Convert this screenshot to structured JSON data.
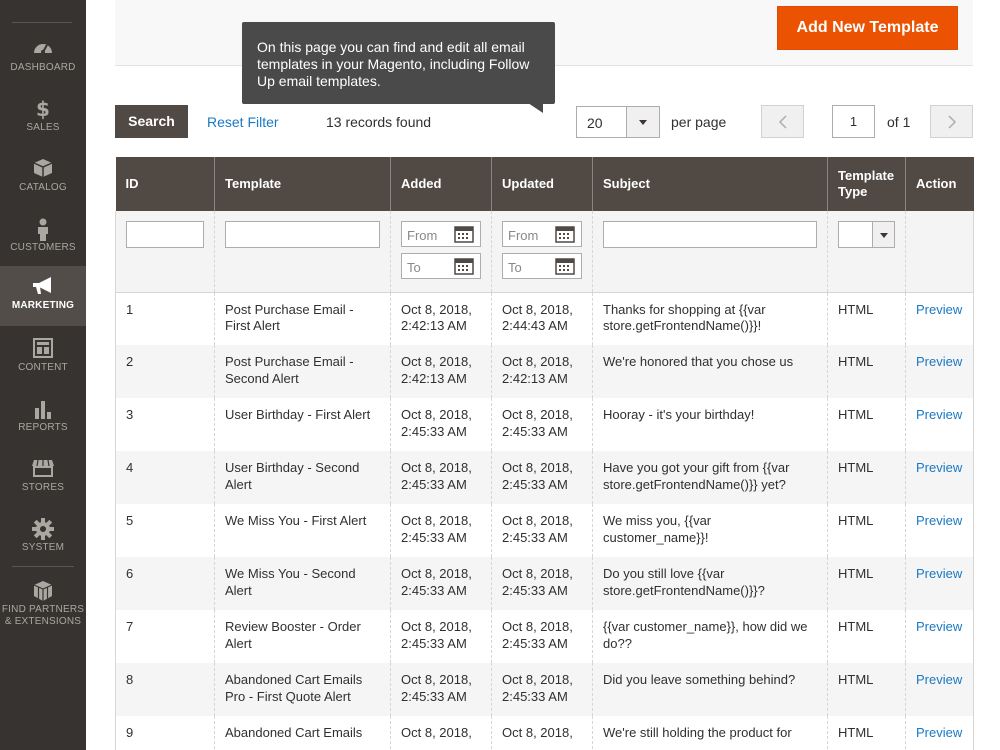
{
  "sidebar": {
    "items": [
      {
        "label": "Dashboard",
        "icon": "dashboard-icon"
      },
      {
        "label": "Sales",
        "icon": "dollar-icon"
      },
      {
        "label": "Catalog",
        "icon": "box-icon"
      },
      {
        "label": "Customers",
        "icon": "person-icon"
      },
      {
        "label": "Marketing",
        "icon": "megaphone-icon"
      },
      {
        "label": "Content",
        "icon": "layout-icon"
      },
      {
        "label": "Reports",
        "icon": "bar-chart-icon"
      },
      {
        "label": "Stores",
        "icon": "storefront-icon"
      },
      {
        "label": "System",
        "icon": "gear-icon"
      },
      {
        "label": "Find Partners",
        "label2": "& Extensions",
        "icon": "cubes-icon"
      }
    ],
    "active": "Marketing"
  },
  "header": {
    "add_button": "Add New Template"
  },
  "tooltip": {
    "text": "On this page you can find and edit all email templates in your Magento, including Follow Up email templates."
  },
  "toolbar": {
    "search": "Search",
    "reset": "Reset Filter",
    "records": "13 records found",
    "per_page_value": "20",
    "per_page_label": "per page",
    "page": "1",
    "of": "of 1"
  },
  "table": {
    "columns": [
      "ID",
      "Template",
      "Added",
      "Updated",
      "Subject",
      "Template Type",
      "Action"
    ],
    "filters": {
      "from": "From",
      "to": "To"
    },
    "rows": [
      {
        "id": "1",
        "template": "Post Purchase Email - First Alert",
        "added": "Oct 8, 2018, 2:42:13 AM",
        "updated": "Oct 8, 2018, 2:44:43 AM",
        "subject": "Thanks for shopping at {{var store.getFrontendName()}}!",
        "type": "HTML",
        "action": "Preview"
      },
      {
        "id": "2",
        "template": "Post Purchase Email - Second Alert",
        "added": "Oct 8, 2018, 2:42:13 AM",
        "updated": "Oct 8, 2018, 2:42:13 AM",
        "subject": "We're honored that you chose us",
        "type": "HTML",
        "action": "Preview"
      },
      {
        "id": "3",
        "template": "User Birthday - First Alert",
        "added": "Oct 8, 2018, 2:45:33 AM",
        "updated": "Oct 8, 2018, 2:45:33 AM",
        "subject": "Hooray - it's your birthday!",
        "type": "HTML",
        "action": "Preview"
      },
      {
        "id": "4",
        "template": "User Birthday - Second Alert",
        "added": "Oct 8, 2018, 2:45:33 AM",
        "updated": "Oct 8, 2018, 2:45:33 AM",
        "subject": "Have you got your gift from {{var store.getFrontendName()}} yet?",
        "type": "HTML",
        "action": "Preview"
      },
      {
        "id": "5",
        "template": "We Miss You - First Alert",
        "added": "Oct 8, 2018, 2:45:33 AM",
        "updated": "Oct 8, 2018, 2:45:33 AM",
        "subject": "We miss you, {{var customer_name}}!",
        "type": "HTML",
        "action": "Preview"
      },
      {
        "id": "6",
        "template": "We Miss You - Second Alert",
        "added": "Oct 8, 2018, 2:45:33 AM",
        "updated": "Oct 8, 2018, 2:45:33 AM",
        "subject": "Do you still love {{var store.getFrontendName()}}?",
        "type": "HTML",
        "action": "Preview"
      },
      {
        "id": "7",
        "template": "Review Booster - Order Alert",
        "added": "Oct 8, 2018, 2:45:33 AM",
        "updated": "Oct 8, 2018, 2:45:33 AM",
        "subject": "{{var customer_name}}, how did we do??",
        "type": "HTML",
        "action": "Preview"
      },
      {
        "id": "8",
        "template": "Abandoned Cart Emails Pro - First Quote Alert",
        "added": "Oct 8, 2018, 2:45:33 AM",
        "updated": "Oct 8, 2018, 2:45:33 AM",
        "subject": "Did you leave something behind?",
        "type": "HTML",
        "action": "Preview"
      },
      {
        "id": "9",
        "template": "Abandoned Cart Emails",
        "added": "Oct 8, 2018,",
        "updated": "Oct 8, 2018,",
        "subject": "We're still holding the product for",
        "type": "HTML",
        "action": "Preview"
      }
    ]
  },
  "colors": {
    "sidebar_bg": "#373330",
    "active_bg": "#524d49",
    "accent": "#eb5202",
    "header_bg": "#514943",
    "link": "#1979c3"
  }
}
